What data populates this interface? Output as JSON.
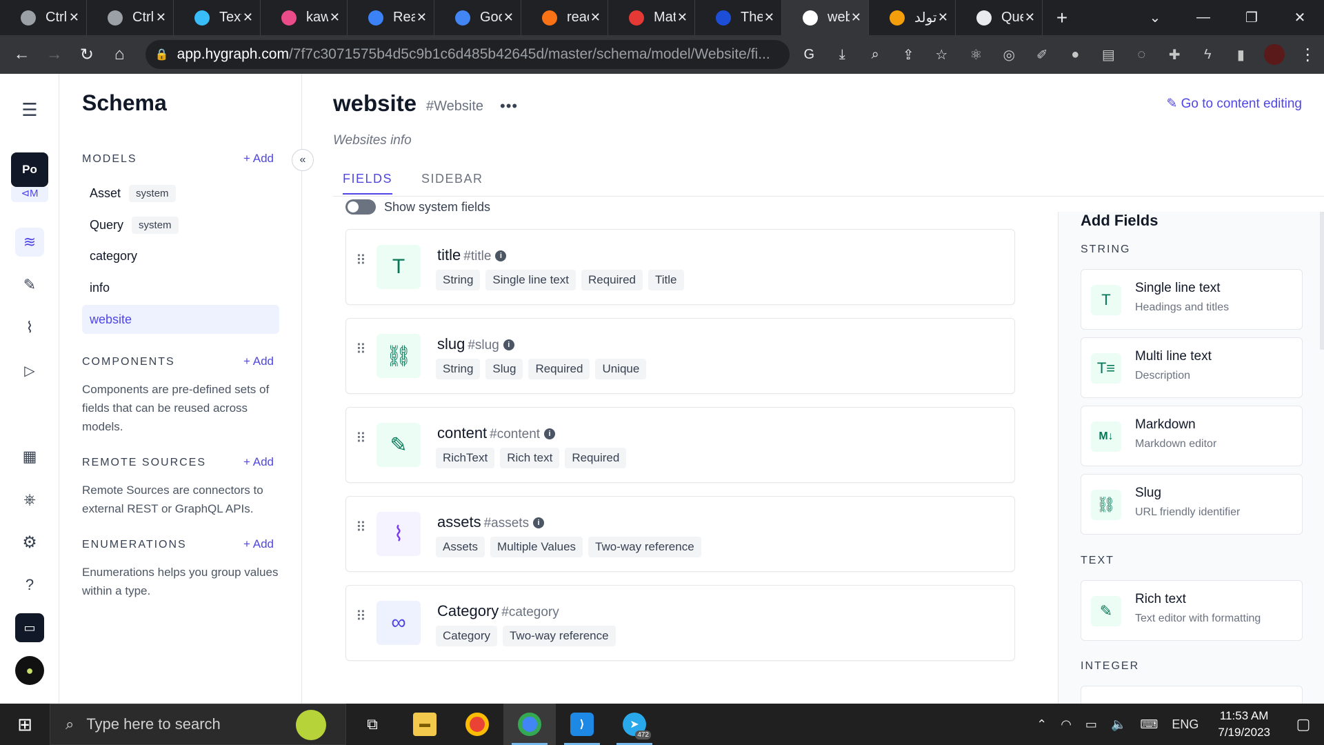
{
  "browser": {
    "tabs": [
      {
        "label": "Ctrl",
        "color": "#9aa0a6"
      },
      {
        "label": "Ctrl",
        "color": "#9aa0a6"
      },
      {
        "label": "Text",
        "color": "#38bdf8"
      },
      {
        "label": "kaw",
        "color": "#ea4c89"
      },
      {
        "label": "Rea",
        "color": "#3b82f6"
      },
      {
        "label": "Goo",
        "color": "#4285f4"
      },
      {
        "label": "reac",
        "color": "#f97316"
      },
      {
        "label": "Mat",
        "color": "#e53935"
      },
      {
        "label": "The",
        "color": "#1d4ed8"
      },
      {
        "label": "web",
        "color": "#ffffff"
      },
      {
        "label": "تولد",
        "color": "#f59e0b"
      },
      {
        "label": "Que",
        "color": "#e8eaed"
      }
    ],
    "url_host": "app.hygraph.com",
    "url_path": "/7f7c3071575b4d5c9b1c6d485b42645d/master/schema/model/Website/fi..."
  },
  "rail": {
    "project_initials": "Po",
    "env_label": "M"
  },
  "schema": {
    "title": "Schema",
    "models_heading": "MODELS",
    "add_label": "Add",
    "models": [
      {
        "name": "Asset",
        "chip": "system"
      },
      {
        "name": "Query",
        "chip": "system"
      },
      {
        "name": "category",
        "chip": ""
      },
      {
        "name": "info",
        "chip": ""
      },
      {
        "name": "website",
        "chip": ""
      }
    ],
    "components_heading": "COMPONENTS",
    "components_desc": "Components are pre-defined sets of fields that can be reused across models.",
    "remote_heading": "REMOTE SOURCES",
    "remote_desc": "Remote Sources are connectors to external REST or GraphQL APIs.",
    "enum_heading": "ENUMERATIONS",
    "enum_desc": "Enumerations helps you group values within a type."
  },
  "model": {
    "name": "website",
    "api_id": "#Website",
    "more": "•••",
    "description": "Websites info",
    "content_link": "Go to content editing",
    "tabs": [
      "FIELDS",
      "SIDEBAR"
    ],
    "toggle_label": "Show system fields"
  },
  "fields": [
    {
      "name": "title",
      "api": "#title",
      "icon": "T",
      "icon_bg": "#ecfdf5",
      "icon_color": "#047857",
      "tags": [
        "String",
        "Single line text",
        "Required",
        "Title"
      ]
    },
    {
      "name": "slug",
      "api": "#slug",
      "icon": "⛓",
      "icon_bg": "#ecfdf5",
      "icon_color": "#047857",
      "tags": [
        "String",
        "Slug",
        "Required",
        "Unique"
      ]
    },
    {
      "name": "content",
      "api": "#content",
      "icon": "✎",
      "icon_bg": "#ecfdf5",
      "icon_color": "#047857",
      "tags": [
        "RichText",
        "Rich text",
        "Required"
      ]
    },
    {
      "name": "assets",
      "api": "#assets",
      "icon": "⌇",
      "icon_bg": "#f5f3ff",
      "icon_color": "#7c3aed",
      "tags": [
        "Assets",
        "Multiple Values",
        "Two-way reference"
      ]
    },
    {
      "name": "Category",
      "api": "#category",
      "icon": "∞",
      "icon_bg": "#eef2ff",
      "icon_color": "#4f46e5",
      "tags": [
        "Category",
        "Two-way reference"
      ]
    }
  ],
  "add_fields": {
    "title": "Add Fields",
    "categories": [
      "STRING",
      "TEXT",
      "INTEGER"
    ],
    "items": [
      {
        "title": "Single line text",
        "subtitle": "Headings and titles",
        "icon": "T"
      },
      {
        "title": "Multi line text",
        "subtitle": "Description",
        "icon": "T≡"
      },
      {
        "title": "Markdown",
        "subtitle": "Markdown editor",
        "icon": "M↓"
      },
      {
        "title": "Slug",
        "subtitle": "URL friendly identifier",
        "icon": "⛓"
      },
      {
        "title": "Rich text",
        "subtitle": "Text editor with formatting",
        "icon": "✎"
      }
    ]
  },
  "taskbar": {
    "search_placeholder": "Type here to search",
    "telegram_badge": "472",
    "lang": "ENG",
    "time": "11:53 AM",
    "date": "7/19/2023"
  }
}
